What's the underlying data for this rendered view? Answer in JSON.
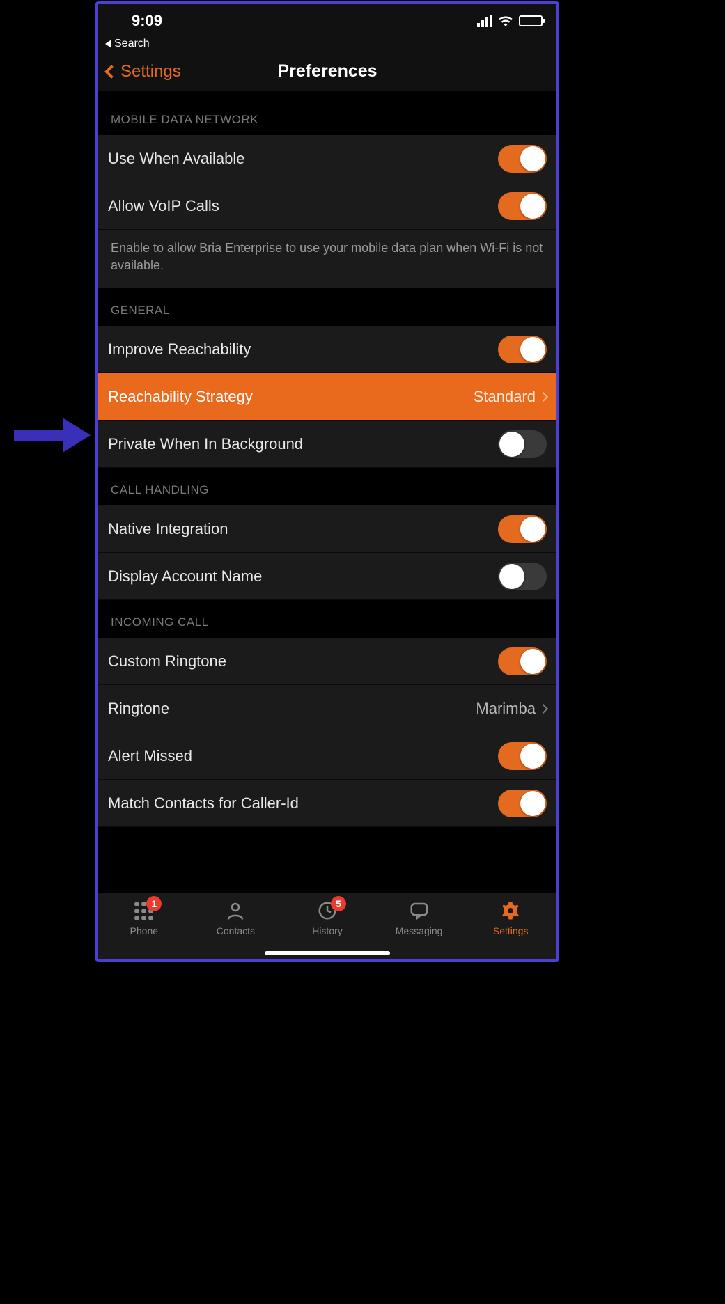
{
  "status": {
    "time": "9:09",
    "breadcrumb": "Search"
  },
  "header": {
    "back": "Settings",
    "title": "Preferences"
  },
  "sections": {
    "mobile": {
      "title": "MOBILE DATA NETWORK",
      "use_when_available": "Use When Available",
      "allow_voip": "Allow VoIP Calls",
      "footer": "Enable to allow Bria Enterprise to use your mobile data plan when Wi-Fi is not available."
    },
    "general": {
      "title": "GENERAL",
      "improve_reach": "Improve Reachability",
      "reach_strategy_label": "Reachability Strategy",
      "reach_strategy_value": "Standard",
      "private_bg": "Private When In Background"
    },
    "call_handling": {
      "title": "CALL HANDLING",
      "native_integration": "Native Integration",
      "display_account_name": "Display Account Name"
    },
    "incoming": {
      "title": "INCOMING CALL",
      "custom_ringtone": "Custom Ringtone",
      "ringtone_label": "Ringtone",
      "ringtone_value": "Marimba",
      "alert_missed": "Alert Missed",
      "match_contacts": "Match Contacts for Caller-Id"
    }
  },
  "toggles": {
    "use_when_available": true,
    "allow_voip": true,
    "improve_reach": true,
    "private_bg": false,
    "native_integration": true,
    "display_account_name": false,
    "custom_ringtone": true,
    "alert_missed": true,
    "match_contacts": true
  },
  "tabs": {
    "phone": {
      "label": "Phone",
      "badge": "1"
    },
    "contacts": {
      "label": "Contacts"
    },
    "history": {
      "label": "History",
      "badge": "5"
    },
    "messaging": {
      "label": "Messaging"
    },
    "settings": {
      "label": "Settings"
    }
  }
}
